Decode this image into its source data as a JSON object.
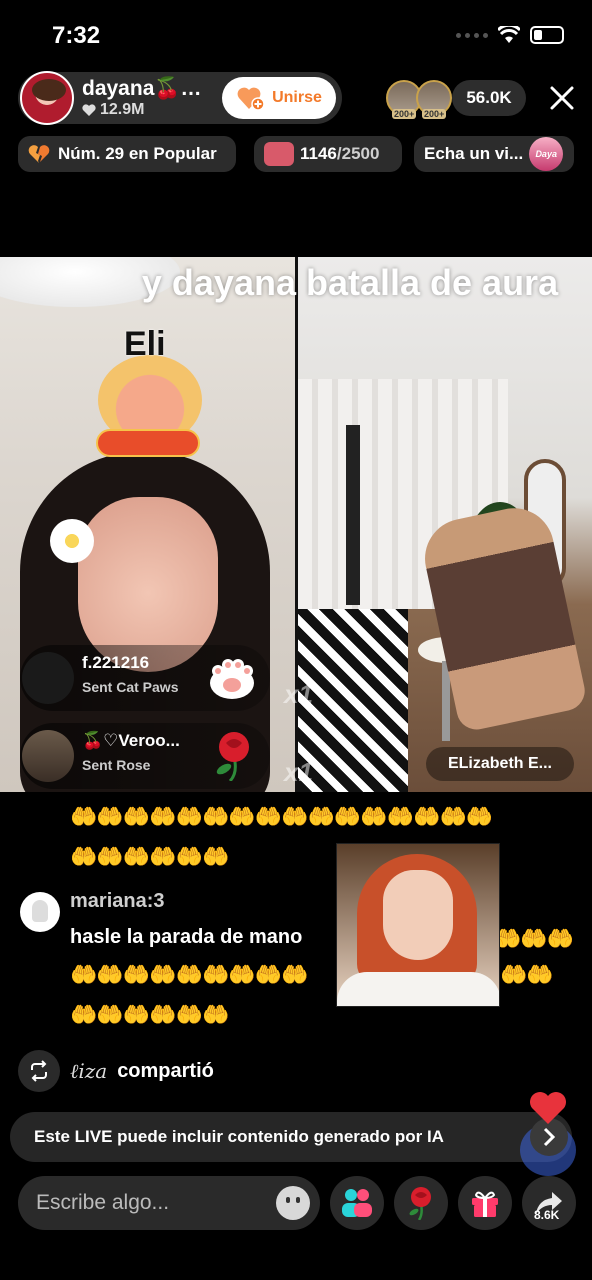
{
  "status_bar": {
    "time": "7:32"
  },
  "host": {
    "name": "dayana🍒…",
    "followers": "12.9M",
    "join_label": "Unirse"
  },
  "viewers": {
    "badges": [
      "200+",
      "200+"
    ],
    "count": "56.0K"
  },
  "chips": {
    "rank": "Núm. 29 en Popular",
    "goal_current": "1146",
    "goal_total": "/2500",
    "explore": "Echa un vi...",
    "explore_badge": "Daya"
  },
  "battle": {
    "title": "y dayana batalla de aura",
    "left_label": "Eli",
    "partner_name": "ELizabeth E..."
  },
  "gift_feed": [
    {
      "user": "f.221216",
      "action": "Sent Cat Paws",
      "multiplier": "x1",
      "gift_icon": "cat-paws-icon"
    },
    {
      "user": "🍒♡Veroo...",
      "action": "Sent Rose",
      "multiplier": "x1",
      "gift_icon": "rose-icon"
    }
  ],
  "chat": {
    "emoji_line1": "🤲🤲🤲🤲🤲🤲🤲🤲🤲🤲🤲🤲🤲🤲🤲🤲",
    "emoji_line2": "🤲🤲🤲🤲🤲🤲",
    "user": "mariana:3",
    "message": "hasle la parada de mano",
    "msg_tail": "🤲🤲🤲",
    "emoji_line3": "🤲🤲🤲🤲🤲🤲🤲🤲🤲",
    "emoji_line3_tail": "🤲🤲",
    "emoji_line4": "🤲🤲🤲🤲🤲🤲"
  },
  "share": {
    "user": "ℓiza",
    "text": "compartió"
  },
  "ai_notice": "Este LIVE puede incluir contenido generado por IA",
  "bottom_bar": {
    "comment_placeholder": "Escribe algo...",
    "share_count": "8.6K"
  },
  "colors": {
    "join_accent": "#f37a2a",
    "heart_red": "#e8333c",
    "background": "#000000"
  }
}
